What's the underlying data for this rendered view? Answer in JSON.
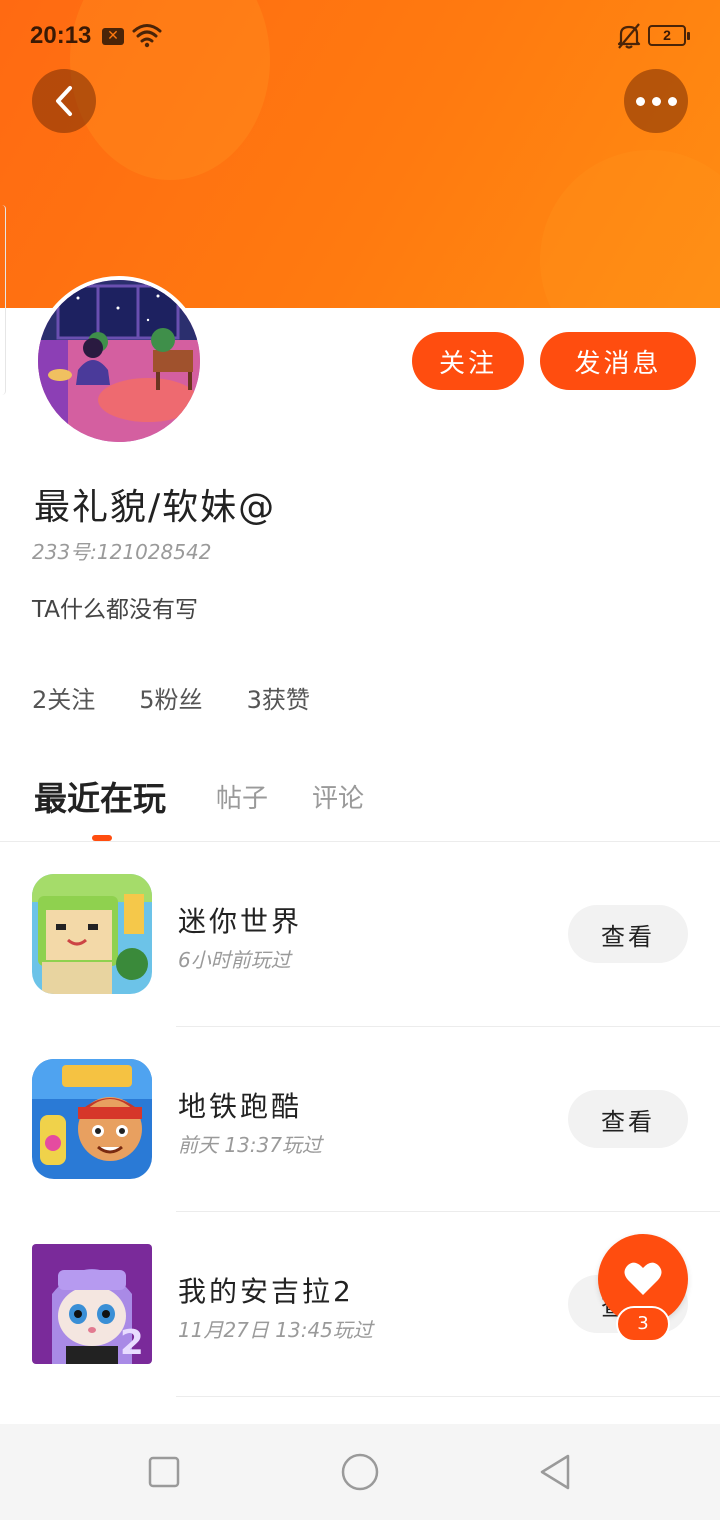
{
  "status_bar": {
    "time": "20:13",
    "notification_icon": "x-box-icon",
    "wifi_icon": "wifi-icon",
    "mute_icon": "bell-off-icon",
    "battery_level": "2"
  },
  "header": {
    "back_icon": "chevron-left-icon",
    "more_icon": "more-dots-icon",
    "accent_color": "#ff6a12"
  },
  "profile": {
    "nickname": "最礼貌/软妹@",
    "user_id": "233号:121028542",
    "bio": "TA什么都没有写",
    "follow_label": "关注",
    "message_label": "发消息",
    "button_color": "#ff4d0f"
  },
  "stats": {
    "following": "2关注",
    "fans": "5粉丝",
    "likes": "3获赞"
  },
  "tabs": [
    {
      "label": "最近在玩",
      "active": true
    },
    {
      "label": "帖子",
      "active": false
    },
    {
      "label": "评论",
      "active": false
    }
  ],
  "games": [
    {
      "name": "迷你世界",
      "time": "6小时前玩过",
      "view_label": "查看"
    },
    {
      "name": "地铁跑酷",
      "time": "前天 13:37玩过",
      "view_label": "查看"
    },
    {
      "name": "我的安吉拉2",
      "time": "11月27日 13:45玩过",
      "view_label": "查看"
    }
  ],
  "fab": {
    "icon": "heart-icon",
    "count": "3"
  },
  "nav_bar": {
    "recents_icon": "square-icon",
    "home_icon": "circle-icon",
    "back_icon": "triangle-back-icon"
  }
}
